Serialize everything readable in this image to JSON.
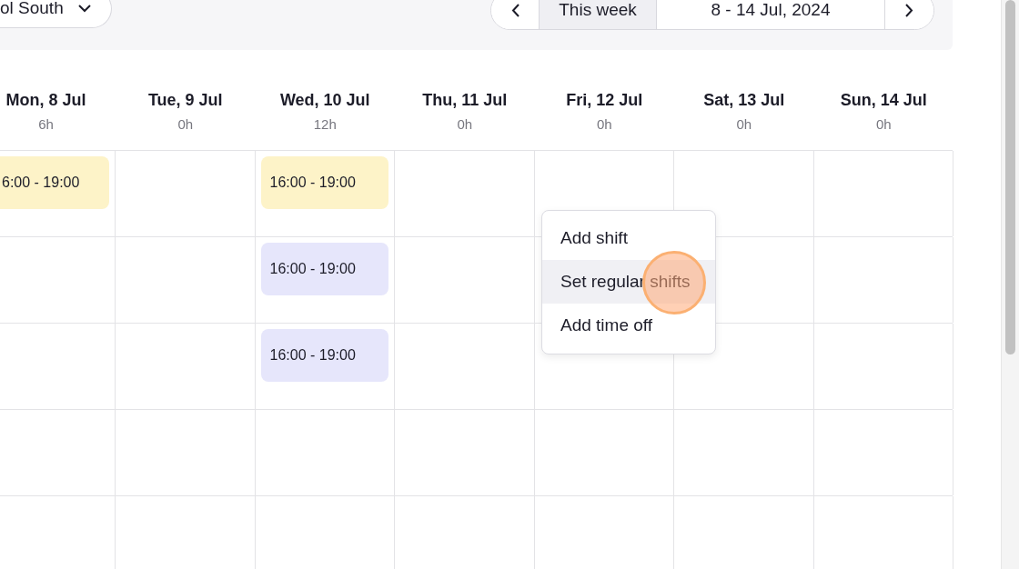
{
  "location_filter": {
    "value": "ol South"
  },
  "week_nav": {
    "today_label": "This week",
    "range": "8 - 14 Jul, 2024"
  },
  "days": [
    {
      "label": "Mon, 8 Jul",
      "hours": "6h"
    },
    {
      "label": "Tue, 9 Jul",
      "hours": "0h"
    },
    {
      "label": "Wed, 10 Jul",
      "hours": "12h"
    },
    {
      "label": "Thu, 11 Jul",
      "hours": "0h"
    },
    {
      "label": "Fri, 12 Jul",
      "hours": "0h"
    },
    {
      "label": "Sat, 13 Jul",
      "hours": "0h"
    },
    {
      "label": "Sun, 14 Jul",
      "hours": "0h"
    }
  ],
  "rows": [
    {
      "cells": [
        {
          "shift": {
            "time": "6:00 - 19:00",
            "color": "#fdf3c8"
          }
        },
        {},
        {
          "shift": {
            "time": "16:00 - 19:00",
            "color": "#fdf3c8"
          }
        },
        {},
        {},
        {},
        {}
      ]
    },
    {
      "cells": [
        {},
        {},
        {
          "shift": {
            "time": "16:00 - 19:00",
            "color": "#e6e6fb"
          }
        },
        {},
        {},
        {},
        {}
      ]
    },
    {
      "cells": [
        {},
        {},
        {
          "shift": {
            "time": "16:00 - 19:00",
            "color": "#e6e6fb"
          }
        },
        {},
        {},
        {},
        {}
      ]
    },
    {
      "cells": [
        {},
        {},
        {},
        {},
        {},
        {},
        {}
      ]
    },
    {
      "cells": [
        {},
        {},
        {},
        {},
        {},
        {},
        {}
      ]
    }
  ],
  "context_menu": {
    "items": [
      {
        "label": "Add shift",
        "selected": false
      },
      {
        "label": "Set regular shifts",
        "selected": true
      },
      {
        "label": "Add time off",
        "selected": false
      }
    ]
  }
}
